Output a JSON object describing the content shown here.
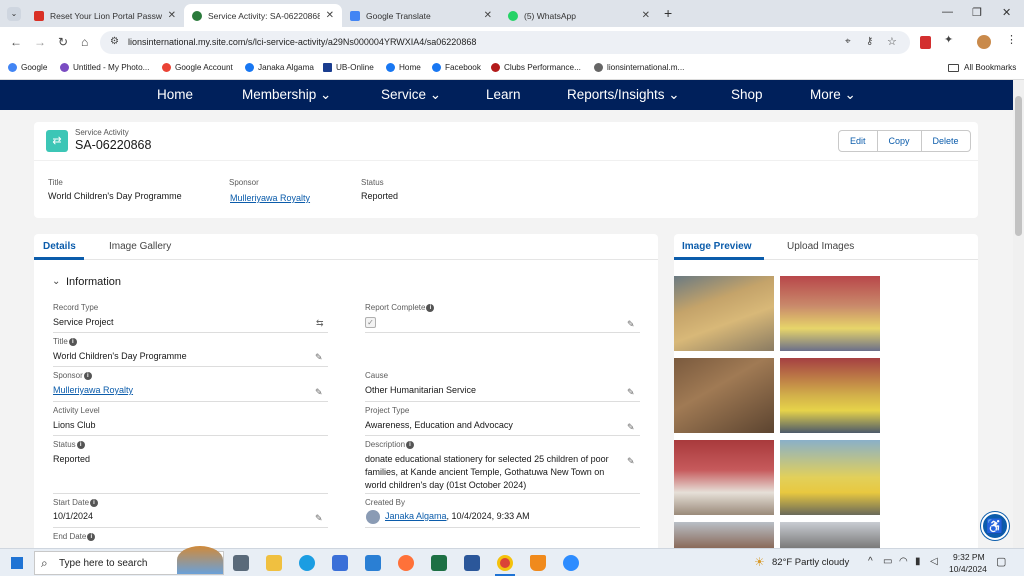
{
  "browser": {
    "tabs": [
      {
        "title": "Reset Your Lion Portal Passwo",
        "color": "#d93025"
      },
      {
        "title": "Service Activity: SA-06220868",
        "color": "#2a7a3b"
      },
      {
        "title": "Google Translate",
        "color": "#4285f4"
      },
      {
        "title": "(5) WhatsApp",
        "color": "#25d366"
      }
    ],
    "url": "lionsinternational.my.site.com/s/lci-service-activity/a29Ns000004YRWXIA4/sa06220868",
    "bookmarks": [
      {
        "label": "Google",
        "color": "#4285f4"
      },
      {
        "label": "Untitled - My Photo...",
        "color": "#7a4cc2"
      },
      {
        "label": "Google Account",
        "color": "#ea4335"
      },
      {
        "label": "Janaka Algama",
        "color": "#1877f2"
      },
      {
        "label": "UB-Online",
        "color": "#1a3d8f"
      },
      {
        "label": "Home",
        "color": "#1877f2"
      },
      {
        "label": "Facebook",
        "color": "#1877f2"
      },
      {
        "label": "Clubs Performance...",
        "color": "#b31b1b"
      },
      {
        "label": "lionsinternational.m...",
        "color": "#666666"
      }
    ],
    "all_bookmarks": "All Bookmarks"
  },
  "nav": {
    "home": "Home",
    "membership": "Membership ⌄",
    "service": "Service ⌄",
    "learn": "Learn",
    "reports": "Reports/Insights ⌄",
    "shop": "Shop",
    "more": "More ⌄"
  },
  "record": {
    "object_label": "Service Activity",
    "name": "SA-06220868",
    "actions": {
      "edit": "Edit",
      "copy": "Copy",
      "delete": "Delete"
    },
    "highlights": {
      "title_label": "Title",
      "title_value": "World Children's Day Programme",
      "sponsor_label": "Sponsor",
      "sponsor_value": "Mulleriyawa Royalty",
      "status_label": "Status",
      "status_value": "Reported"
    }
  },
  "details": {
    "tabs": {
      "details": "Details",
      "gallery": "Image Gallery"
    },
    "section_title": "Information",
    "fields": {
      "record_type_label": "Record Type",
      "record_type_value": "Service Project",
      "report_complete_label": "Report Complete",
      "title_label": "Title",
      "title_value": "World Children's Day Programme",
      "sponsor_label": "Sponsor",
      "sponsor_value": "Mulleriyawa Royalty",
      "cause_label": "Cause",
      "cause_value": "Other Humanitarian Service",
      "activity_level_label": "Activity Level",
      "activity_level_value": "Lions Club",
      "project_type_label": "Project Type",
      "project_type_value": "Awareness, Education and Advocacy",
      "status_label": "Status",
      "status_value": "Reported",
      "description_label": "Description",
      "description_line1": "donate educational stationery for selected 25 children of poor",
      "description_line2": "families, at Kande ancient Temple, Gothatuwa New Town on",
      "description_line3": "world children's day (01st October 2024)",
      "start_date_label": "Start Date",
      "start_date_value": "10/1/2024",
      "created_by_label": "Created By",
      "created_by_name": "Janaka Algama",
      "created_by_date": ", 10/4/2024, 9:33 AM",
      "end_date_label": "End Date"
    }
  },
  "preview": {
    "tabs": {
      "preview": "Image Preview",
      "upload": "Upload Images"
    }
  },
  "taskbar": {
    "search_placeholder": "Type here to search",
    "weather": "82°F  Partly cloudy",
    "time": "9:32 PM",
    "date": "10/4/2024"
  }
}
